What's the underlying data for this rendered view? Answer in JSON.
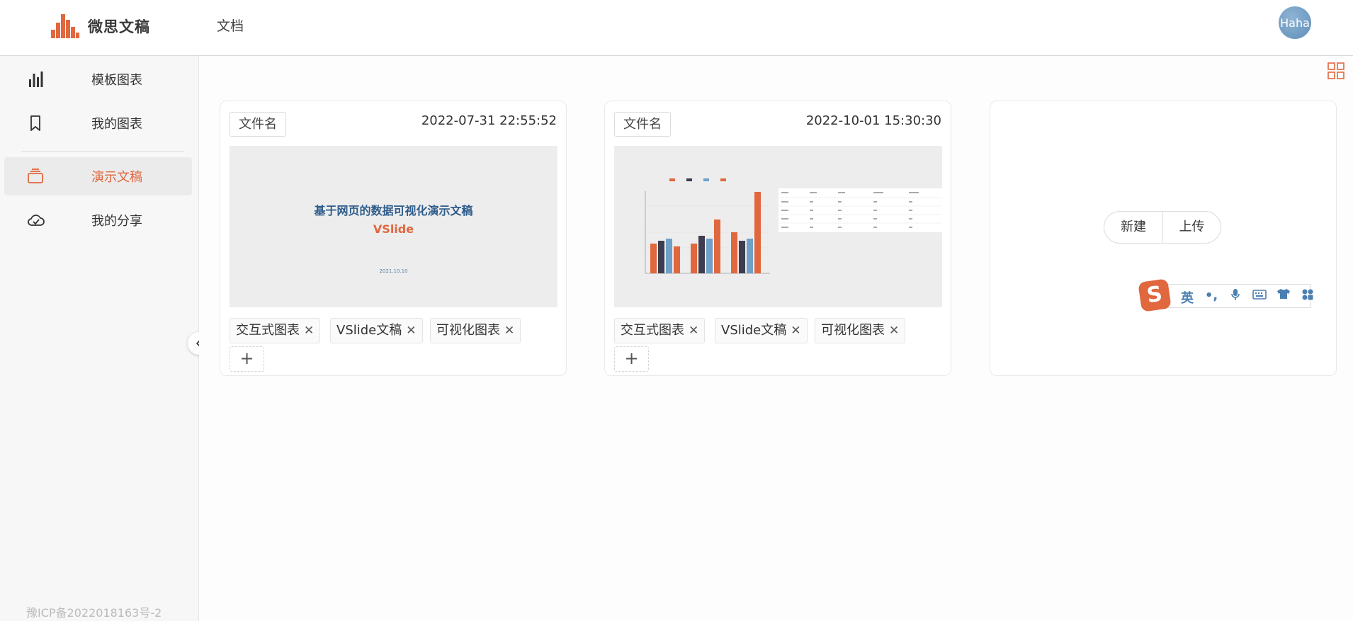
{
  "header": {
    "brand": "微思文稿",
    "nav_docs": "文档",
    "avatar_text": "Haha"
  },
  "sidebar": {
    "items": [
      {
        "label": "模板图表",
        "icon": "bar-chart-icon",
        "active": false
      },
      {
        "label": "我的图表",
        "icon": "bookmark-icon",
        "active": false
      },
      {
        "label": "演示文稿",
        "icon": "slides-stack-icon",
        "active": true
      },
      {
        "label": "我的分享",
        "icon": "cloud-check-icon",
        "active": false
      }
    ],
    "icp": "豫ICP备2022018163号-2"
  },
  "cards": [
    {
      "filename_placeholder": "文件名",
      "date": "2022-07-31 22:55:52",
      "thumbnail": {
        "title": "基于网页的数据可视化演示文稿",
        "subtitle": "VSlide",
        "date": "2021.10.10"
      },
      "tags": [
        "交互式图表",
        "VSlide文稿",
        "可视化图表"
      ]
    },
    {
      "filename_placeholder": "文件名",
      "date": "2022-10-01 15:30:30",
      "thumbnail": {
        "type": "bar-chart-with-table"
      },
      "tags": [
        "交互式图表",
        "VSlide文稿",
        "可视化图表"
      ]
    }
  ],
  "new_card": {
    "new_label": "新建",
    "upload_label": "上传"
  },
  "ime": {
    "mode": "英",
    "items": [
      "•,",
      "mic",
      "keyboard",
      "shirt",
      "apps"
    ]
  },
  "colors": {
    "accent": "#e0673e",
    "sidebar_bg": "#f7f7f7",
    "active_bg": "#ebebeb"
  }
}
